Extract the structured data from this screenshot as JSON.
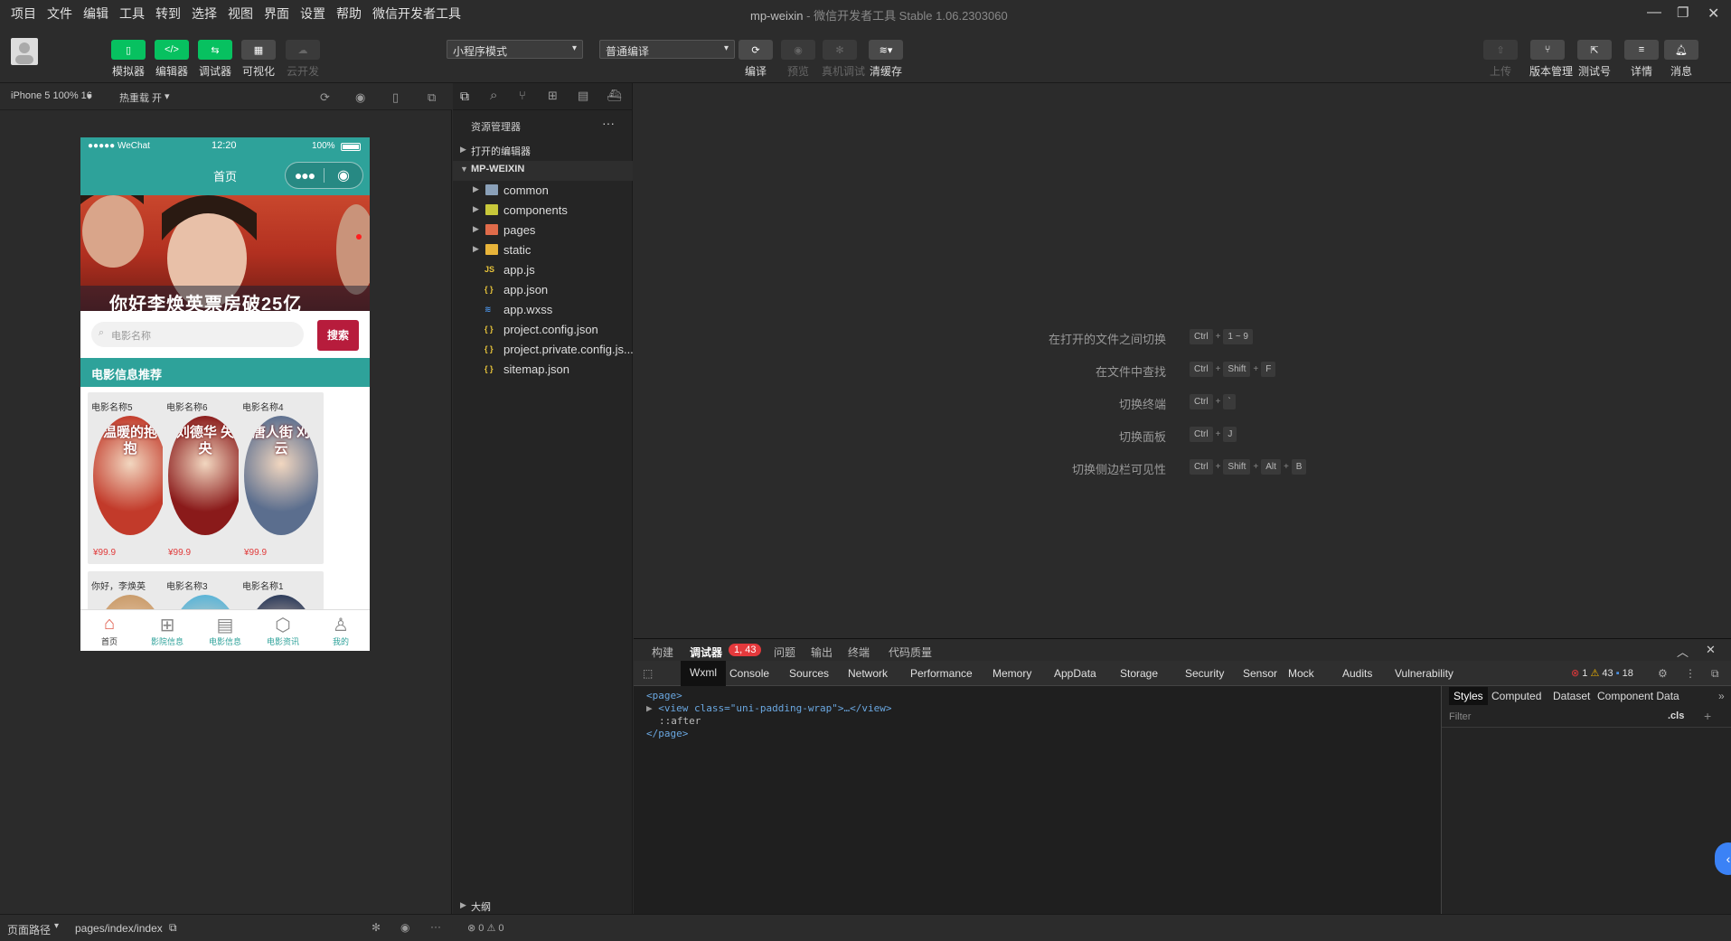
{
  "menu": [
    "项目",
    "文件",
    "编辑",
    "工具",
    "转到",
    "选择",
    "视图",
    "界面",
    "设置",
    "帮助",
    "微信开发者工具"
  ],
  "window": {
    "title": "mp-weixin",
    "subtitle": " - 微信开发者工具 Stable 1.06.2303060"
  },
  "toolbar": {
    "left": [
      {
        "icon": "phone-icon",
        "label": "模拟器"
      },
      {
        "icon": "code-icon",
        "label": "编辑器"
      },
      {
        "icon": "debug-icon",
        "label": "调试器"
      },
      {
        "icon": "layout-icon",
        "label": "可视化"
      },
      {
        "icon": "cloud-icon",
        "label": "云开发"
      }
    ],
    "mode_select": "小程序模式",
    "compile_select": "普通编译",
    "mid": [
      {
        "icon": "refresh-icon",
        "label": "编译"
      },
      {
        "icon": "eye-icon",
        "label": "预览"
      },
      {
        "icon": "bug-icon",
        "label": "真机调试"
      },
      {
        "icon": "layers-icon",
        "label": "清缓存"
      }
    ],
    "right": [
      {
        "icon": "upload-icon",
        "label": "上传"
      },
      {
        "icon": "branch-icon",
        "label": "版本管理"
      },
      {
        "icon": "external-icon",
        "label": "测试号"
      },
      {
        "icon": "menu-icon",
        "label": "详情"
      },
      {
        "icon": "bell-icon",
        "label": "消息"
      }
    ]
  },
  "simulator": {
    "device": "iPhone 5 100% 16",
    "hotreload": "热重载 开",
    "status": {
      "carrier": "●●●●● WeChat",
      "time": "12:20",
      "battery": "100%"
    },
    "nav_title": "首页",
    "banner_text": "你好李焕英票房破25亿",
    "search_placeholder": "电影名称",
    "search_button": "搜索",
    "section_title": "电影信息推荐",
    "movies": [
      {
        "name": "电影名称5",
        "price": "¥99.9",
        "poster_text": "温暖的抱抱",
        "color": "#c23a2a"
      },
      {
        "name": "电影名称6",
        "price": "¥99.9",
        "poster_text": "刘德华 失央",
        "color": "#8a1a1a"
      },
      {
        "name": "电影名称4",
        "price": "¥99.9",
        "poster_text": "唐人街 刈云",
        "color": "#5b6e8e"
      },
      {
        "name": "你好，李焕英",
        "price": "",
        "poster_text": "",
        "color": "#c99b6a"
      },
      {
        "name": "电影名称3",
        "price": "",
        "poster_text": "",
        "color": "#5ab4d8"
      },
      {
        "name": "电影名称1",
        "price": "",
        "poster_text": "",
        "color": "#2a3a5a"
      }
    ],
    "tabs": [
      {
        "icon": "home-icon",
        "label": "首页"
      },
      {
        "icon": "grid-icon",
        "label": "影院信息"
      },
      {
        "icon": "film-icon",
        "label": "电影信息"
      },
      {
        "icon": "box-icon",
        "label": "电影资讯"
      },
      {
        "icon": "user-icon",
        "label": "我的"
      }
    ]
  },
  "explorer": {
    "title": "资源管理器",
    "open_editors": "打开的编辑器",
    "root": "MP-WEIXIN",
    "items": [
      {
        "type": "folder",
        "name": "common",
        "color": "#8aa0b8"
      },
      {
        "type": "folder",
        "name": "components",
        "color": "#c8c83a"
      },
      {
        "type": "folder",
        "name": "pages",
        "color": "#e06b4a"
      },
      {
        "type": "folder",
        "name": "static",
        "color": "#e8b43a"
      },
      {
        "type": "js",
        "name": "app.js"
      },
      {
        "type": "json",
        "name": "app.json"
      },
      {
        "type": "wxss",
        "name": "app.wxss"
      },
      {
        "type": "json",
        "name": "project.config.json"
      },
      {
        "type": "json",
        "name": "project.private.config.js..."
      },
      {
        "type": "json",
        "name": "sitemap.json"
      }
    ],
    "outline": "大纲"
  },
  "shortcuts": [
    {
      "label": "在打开的文件之间切换",
      "keys": [
        "Ctrl",
        "1 ~ 9"
      ]
    },
    {
      "label": "在文件中查找",
      "keys": [
        "Ctrl",
        "Shift",
        "F"
      ]
    },
    {
      "label": "切换终端",
      "keys": [
        "Ctrl",
        "`"
      ]
    },
    {
      "label": "切换面板",
      "keys": [
        "Ctrl",
        "J"
      ]
    },
    {
      "label": "切换侧边栏可见性",
      "keys": [
        "Ctrl",
        "Shift",
        "Alt",
        "B"
      ]
    }
  ],
  "devtools": {
    "top_tabs": [
      "构建",
      "调试器",
      "问题",
      "输出",
      "终端",
      "代码质量"
    ],
    "badge": "1, 43",
    "tabs": [
      "Wxml",
      "Console",
      "Sources",
      "Network",
      "Performance",
      "Memory",
      "AppData",
      "Storage",
      "Security",
      "Sensor",
      "Mock",
      "Audits",
      "Vulnerability"
    ],
    "counts": {
      "errors": "1",
      "warnings": "43",
      "info": "18"
    },
    "wxml": {
      "open": "<page>",
      "view": "<view class=\"uni-padding-wrap\">…</view>",
      "after": "::after",
      "close": "</page>"
    },
    "styles_tabs": [
      "Styles",
      "Computed",
      "Dataset",
      "Component Data"
    ],
    "filter": "Filter",
    "cls": ".cls"
  },
  "bottom": {
    "path_label": "页面路径",
    "path": "pages/index/index",
    "errors": "0",
    "warnings": "0"
  }
}
